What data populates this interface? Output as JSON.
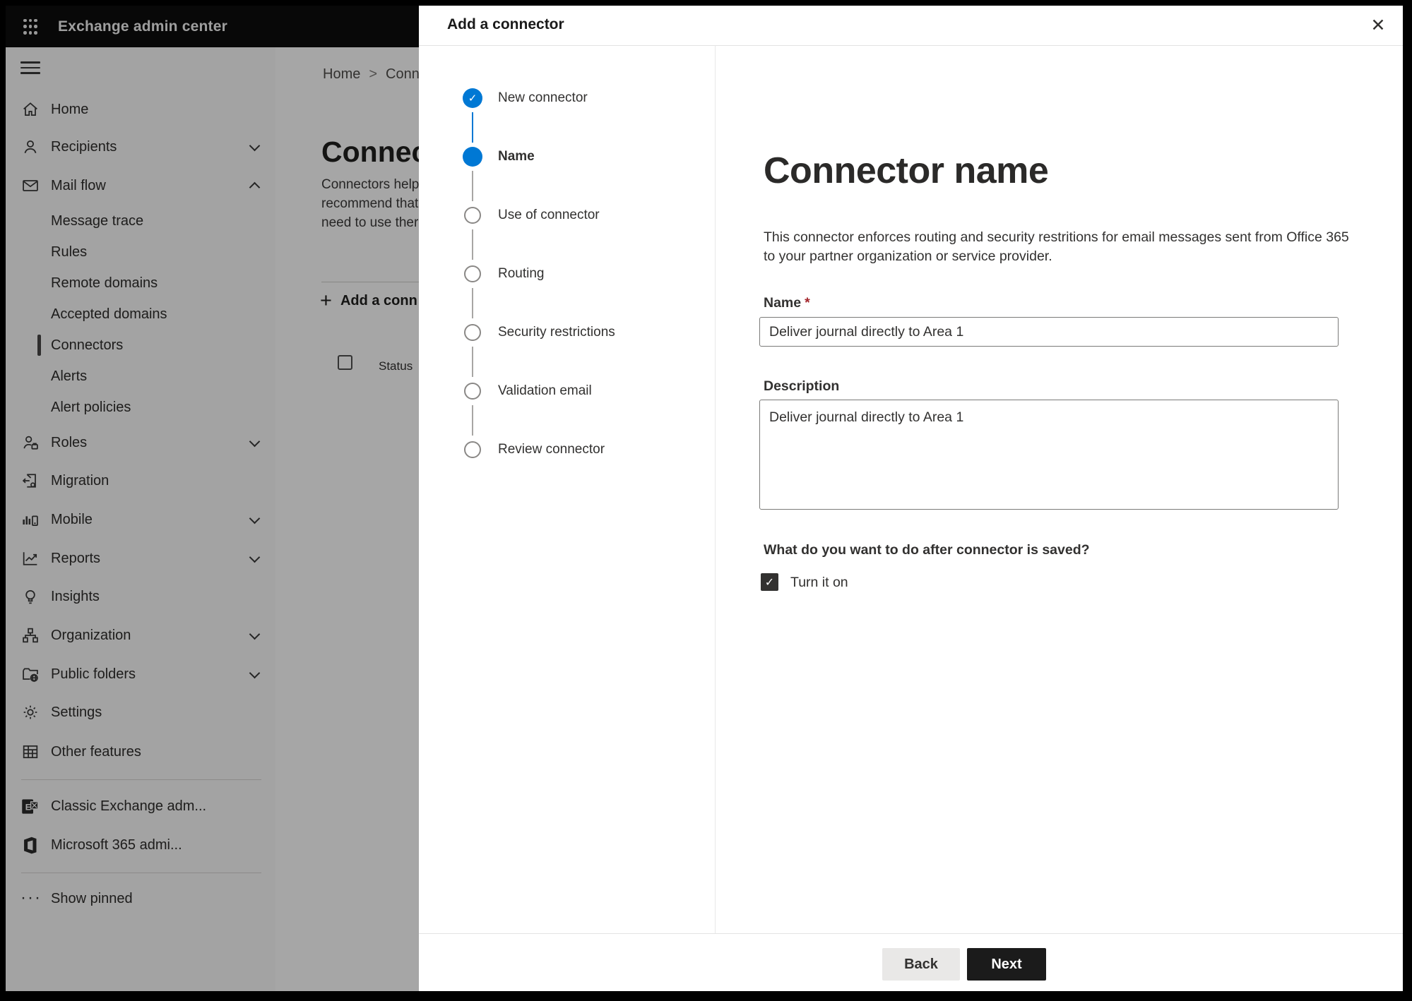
{
  "app": {
    "title": "Exchange admin center"
  },
  "colors": {
    "accent": "#0078d4",
    "required_marker": "#a4262c",
    "topbar_bg": "#0d0d0d",
    "next_button_bg": "#1b1b1b",
    "back_button_bg": "#e9e8e7"
  },
  "icons": {
    "check": "✓",
    "close": "✕",
    "plus": "+",
    "breadcrumb_separator": ">",
    "show_pinned_ellipsis": "···"
  },
  "sidebar": {
    "items": [
      {
        "label": "Home"
      },
      {
        "label": "Recipients",
        "chevron": "down"
      },
      {
        "label": "Mail flow",
        "chevron": "up"
      },
      {
        "label": "Message trace"
      },
      {
        "label": "Rules"
      },
      {
        "label": "Remote domains"
      },
      {
        "label": "Accepted domains"
      },
      {
        "label": "Connectors",
        "selected": true
      },
      {
        "label": "Alerts"
      },
      {
        "label": "Alert policies"
      },
      {
        "label": "Roles",
        "chevron": "down"
      },
      {
        "label": "Migration"
      },
      {
        "label": "Mobile",
        "chevron": "down"
      },
      {
        "label": "Reports",
        "chevron": "down"
      },
      {
        "label": "Insights"
      },
      {
        "label": "Organization",
        "chevron": "down"
      },
      {
        "label": "Public folders",
        "chevron": "down"
      },
      {
        "label": "Settings"
      },
      {
        "label": "Other features"
      },
      {
        "label": "Classic Exchange adm..."
      },
      {
        "label": "Microsoft 365 admi..."
      },
      {
        "label": "Show pinned"
      }
    ]
  },
  "background_page": {
    "breadcrumb": {
      "home": "Home",
      "current": "Conne"
    },
    "title": "Connect",
    "paragraph_lines": [
      "Connectors help",
      "recommend that",
      "need to use ther"
    ],
    "add_button_label": "Add a conn",
    "status_header": "Status"
  },
  "dialog": {
    "title": "Add a connector",
    "steps": [
      {
        "label": "New connector",
        "state": "done"
      },
      {
        "label": "Name",
        "state": "current"
      },
      {
        "label": "Use of connector",
        "state": "upcoming"
      },
      {
        "label": "Routing",
        "state": "upcoming"
      },
      {
        "label": "Security restrictions",
        "state": "upcoming"
      },
      {
        "label": "Validation email",
        "state": "upcoming"
      },
      {
        "label": "Review connector",
        "state": "upcoming"
      }
    ],
    "content": {
      "heading": "Connector name",
      "description_lines": [
        "This connector enforces routing and security restritions for email messages sent from Office 365",
        "to your partner organization or service provider."
      ],
      "name_label": "Name",
      "required_marker": "*",
      "name_value": "Deliver journal directly to Area 1",
      "description_label": "Description",
      "description_value": "Deliver journal directly to Area 1",
      "after_save_question": "What do you want to do after connector is saved?",
      "turn_on_label": "Turn it on",
      "turn_on_checked": true
    },
    "footer": {
      "back": "Back",
      "next": "Next"
    }
  }
}
